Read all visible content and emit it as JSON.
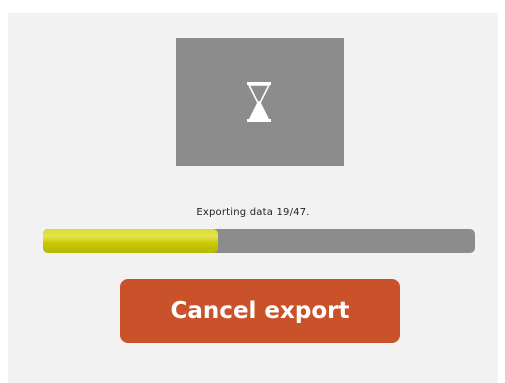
{
  "status": {
    "text": "Exporting data  19/47."
  },
  "progress": {
    "current": 19,
    "total": 47,
    "fraction": 0.404,
    "fill_color": "#c7c700"
  },
  "thumbnail": {
    "icon": "hourglass-icon"
  },
  "actions": {
    "cancel_label": "Cancel export",
    "cancel_color": "#c9522a"
  }
}
